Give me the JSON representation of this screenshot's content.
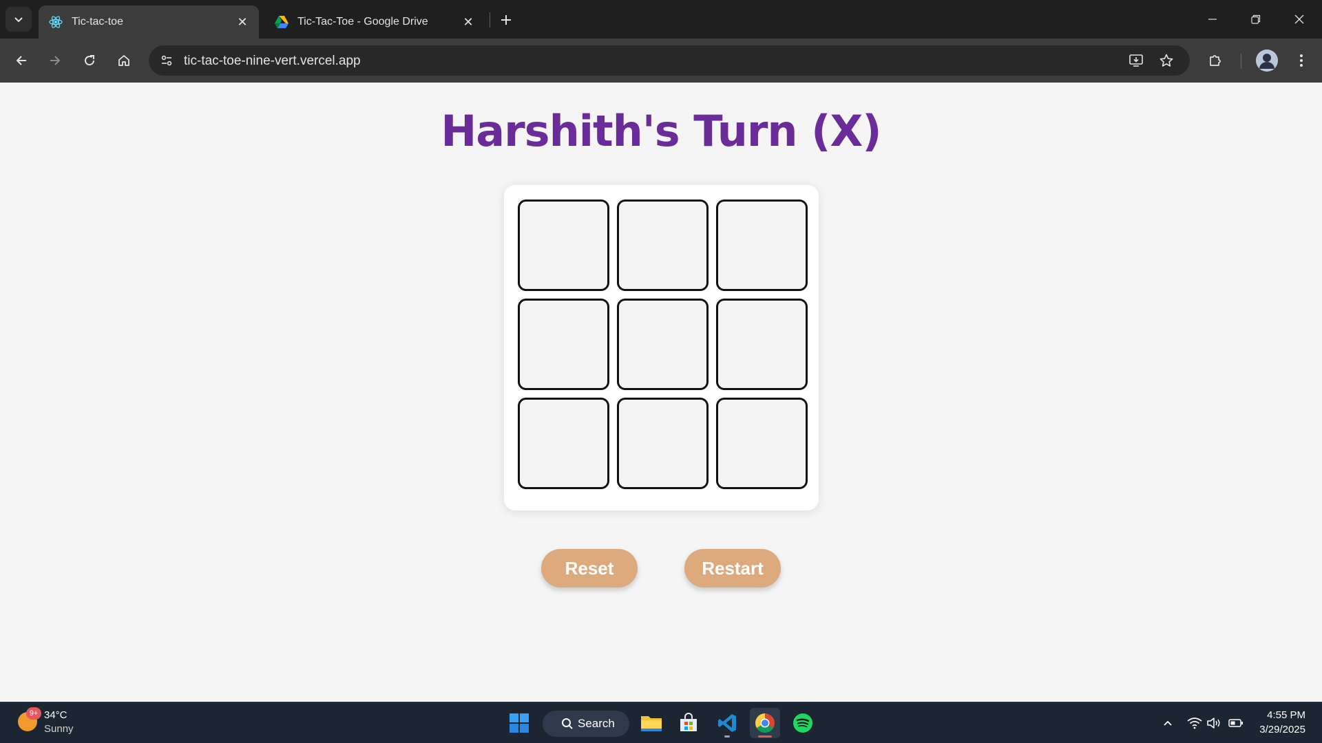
{
  "browser": {
    "tabs": [
      {
        "title": "Tic-tac-toe",
        "active": true,
        "icon": "react-icon"
      },
      {
        "title": "Tic-Tac-Toe - Google Drive",
        "active": false,
        "icon": "google-drive-icon"
      }
    ],
    "url": "tic-tac-toe-nine-vert.vercel.app"
  },
  "game": {
    "heading": "Harshith's Turn (X)",
    "board": [
      "",
      "",
      "",
      "",
      "",
      "",
      "",
      "",
      ""
    ],
    "reset_label": "Reset",
    "restart_label": "Restart",
    "colors": {
      "heading": "#6a2c99",
      "button": "#dcaa7c"
    }
  },
  "taskbar": {
    "weather": {
      "badge": "9+",
      "temp": "34°C",
      "condition": "Sunny"
    },
    "search_label": "Search",
    "apps": [
      "start-icon",
      "search",
      "file-explorer-icon",
      "microsoft-store-icon",
      "vscode-icon",
      "chrome-icon",
      "spotify-icon"
    ],
    "clock": {
      "time": "4:55 PM",
      "date": "3/29/2025"
    }
  }
}
